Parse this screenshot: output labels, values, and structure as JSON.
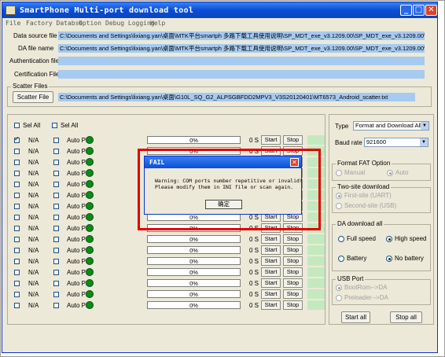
{
  "window": {
    "title": "SmartPhone Multi-port download tool",
    "min": "_",
    "max": "□",
    "close": "✕"
  },
  "menu": [
    "File",
    "Factory Databse",
    "Option",
    "Debug Logging",
    "Help"
  ],
  "fields": {
    "da_source_label": "Data source file",
    "da_source_value": "C:\\Documents and Settings\\lixiang.yan\\桌面\\MTK平台smartph 多路下载工具使用说明\\SP_MDT_exe_v3.1209.00\\SP_MDT_exe_v3.1209.00\\MTK_D",
    "da_file_label": "DA file name",
    "da_file_value": "C:\\Documents and Settings\\lixiang.yan\\桌面\\MTK平台smartph 多路下载工具使用说明\\SP_MDT_exe_v3.1209.00\\SP_MDT_exe_v3.1209.00\\MTK_A",
    "auth_label": "Authentication file",
    "cert_label": "Certification File"
  },
  "scatter": {
    "group": "Scatter Files",
    "button": "Scatter File",
    "value": "C:\\Documents and Settings\\lixiang.yan\\桌面\\G10L_SQ_G2_ALPSGBFDD2MPV3_V3S20120401\\MT6573_Android_scatter.txt"
  },
  "selall": {
    "a": "Sel All",
    "b": "Sel All"
  },
  "rows": [
    {
      "na": "N/A",
      "ap": "Auto PL",
      "pct": "0%",
      "t": "0 S",
      "start": "Start",
      "stop": "Stop",
      "checked": true
    },
    {
      "na": "N/A",
      "ap": "Auto PL",
      "pct": "0%",
      "t": "0 S",
      "start": "Start",
      "stop": "Stop",
      "checked": false
    },
    {
      "na": "N/A",
      "ap": "Auto PL",
      "pct": "0%",
      "t": "0 S",
      "start": "Start",
      "stop": "Stop",
      "checked": false
    },
    {
      "na": "N/A",
      "ap": "Auto PL",
      "pct": "0%",
      "t": "0 S",
      "start": "Start",
      "stop": "Stop",
      "checked": false
    },
    {
      "na": "N/A",
      "ap": "Auto PL",
      "pct": "0%",
      "t": "0 S",
      "start": "Start",
      "stop": "Stop",
      "checked": false
    },
    {
      "na": "N/A",
      "ap": "Auto PL",
      "pct": "0%",
      "t": "0 S",
      "start": "Start",
      "stop": "Stop",
      "checked": false
    },
    {
      "na": "N/A",
      "ap": "Auto PL",
      "pct": "0%",
      "t": "0 S",
      "start": "Start",
      "stop": "Stop",
      "checked": false
    },
    {
      "na": "N/A",
      "ap": "Auto PL",
      "pct": "0%",
      "t": "0 S",
      "start": "Start",
      "stop": "Stop",
      "checked": false
    },
    {
      "na": "N/A",
      "ap": "Auto PL",
      "pct": "0%",
      "t": "0 S",
      "start": "Start",
      "stop": "Stop",
      "checked": false
    },
    {
      "na": "N/A",
      "ap": "Auto PL",
      "pct": "0%",
      "t": "0 S",
      "start": "Start",
      "stop": "Stop",
      "checked": false
    },
    {
      "na": "N/A",
      "ap": "Auto PL",
      "pct": "0%",
      "t": "0 S",
      "start": "Start",
      "stop": "Stop",
      "checked": false
    },
    {
      "na": "N/A",
      "ap": "Auto PL",
      "pct": "0%",
      "t": "0 S",
      "start": "Start",
      "stop": "Stop",
      "checked": false
    },
    {
      "na": "N/A",
      "ap": "Auto PL",
      "pct": "0%",
      "t": "0 S",
      "start": "Start",
      "stop": "Stop",
      "checked": false
    },
    {
      "na": "N/A",
      "ap": "Auto PL",
      "pct": "0%",
      "t": "0 S",
      "start": "Start",
      "stop": "Stop",
      "checked": false
    },
    {
      "na": "N/A",
      "ap": "Auto PL",
      "pct": "0%",
      "t": "0 S",
      "start": "Start",
      "stop": "Stop",
      "checked": false
    },
    {
      "na": "N/A",
      "ap": "Auto PL",
      "pct": "0%",
      "t": "0 S",
      "start": "Start",
      "stop": "Stop",
      "checked": false
    }
  ],
  "right": {
    "type_label": "Type",
    "type_value": "Format and Download All",
    "baud_label": "Baud rate",
    "baud_value": "921600",
    "fat_group": "Format FAT Option",
    "fat_manual": "Manual",
    "fat_auto": "Auto",
    "two_group": "Two-site download",
    "two_first": "First-site (UART)",
    "two_second": "Second-site (USB)",
    "da_group": "DA download all",
    "full": "Full speed",
    "high": "High speed",
    "battery": "Battery",
    "nobattery": "No battery",
    "usb_group": "USB Port",
    "usb_a": "BootRom-->DA",
    "usb_b": "Preloader-->DA",
    "start_all": "Start all",
    "stop_all": "Stop all"
  },
  "dialog": {
    "title": "FAIL",
    "close": "✕",
    "message": "Warning: COM ports number repetitive or invalid!\nPlease modify them in INI file or scan again.",
    "ok": "确定"
  },
  "colors": {
    "title": "#0a4fd4",
    "field": "#a6caf0",
    "highlight": "#e00000",
    "led": "#0a8c17"
  }
}
